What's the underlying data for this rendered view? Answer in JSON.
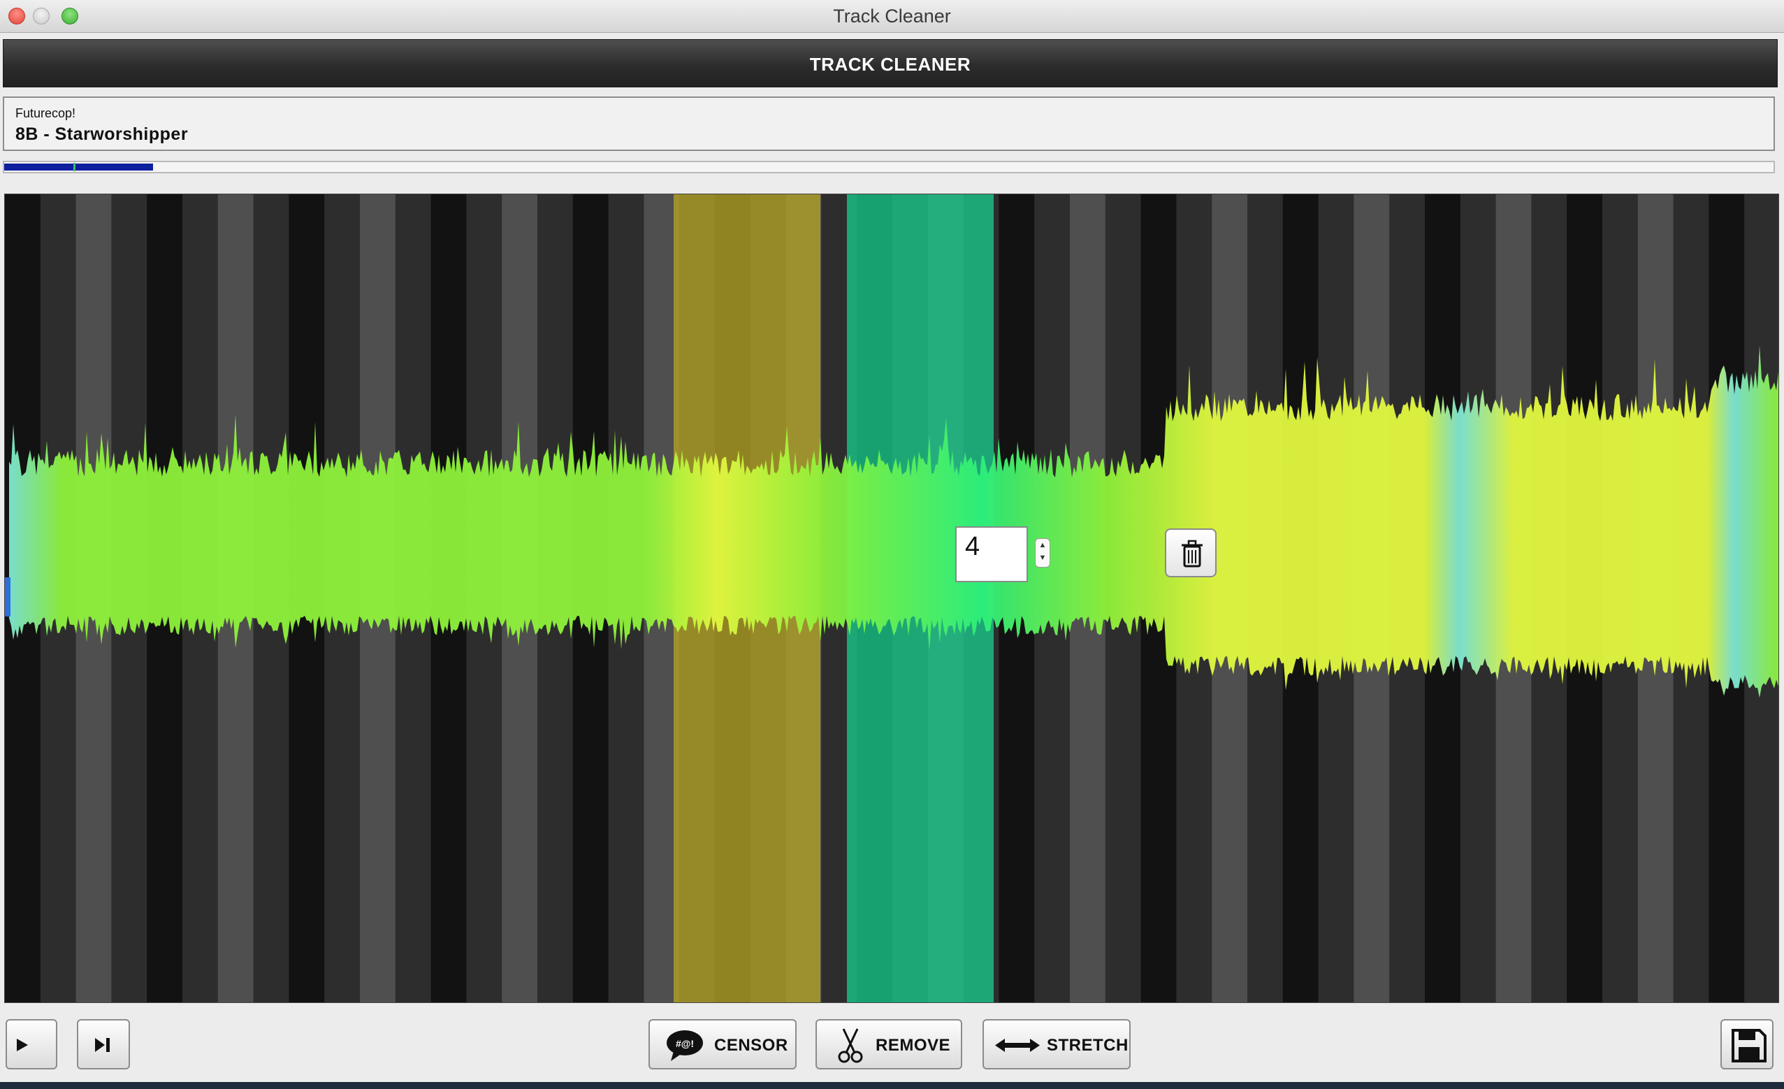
{
  "window": {
    "title": "Track Cleaner"
  },
  "header": {
    "title": "TRACK CLEANER"
  },
  "track": {
    "artist": "Futurecop!",
    "title": "8B - Starworshipper"
  },
  "playback": {
    "progress_fraction": 0.084,
    "marker_fraction": 0.039
  },
  "waveform": {
    "icon_name": "waveform",
    "beat_count_value": "4",
    "colors": {
      "wave_green": "#8ef23a",
      "wave_yellow": "#e2f83f",
      "wave_cyan": "#7ee8d6",
      "censor_region": "#b3a427",
      "remove_region": "#19c98a",
      "bar_dark": "#121212",
      "bar_mid": "#2d2d2d",
      "bar_light": "#4f4f4f"
    }
  },
  "toolbar": {
    "play_icon": "play-icon",
    "skip_icon": "skip-forward-icon",
    "censor_label": "CENSOR",
    "censor_icon": "speech-bubble-icon",
    "remove_label": "REMOVE",
    "remove_icon": "scissors-icon",
    "stretch_label": "STRETCH",
    "stretch_icon": "double-arrow-icon",
    "save_icon": "floppy-disk-icon",
    "delete_icon": "trash-icon"
  }
}
